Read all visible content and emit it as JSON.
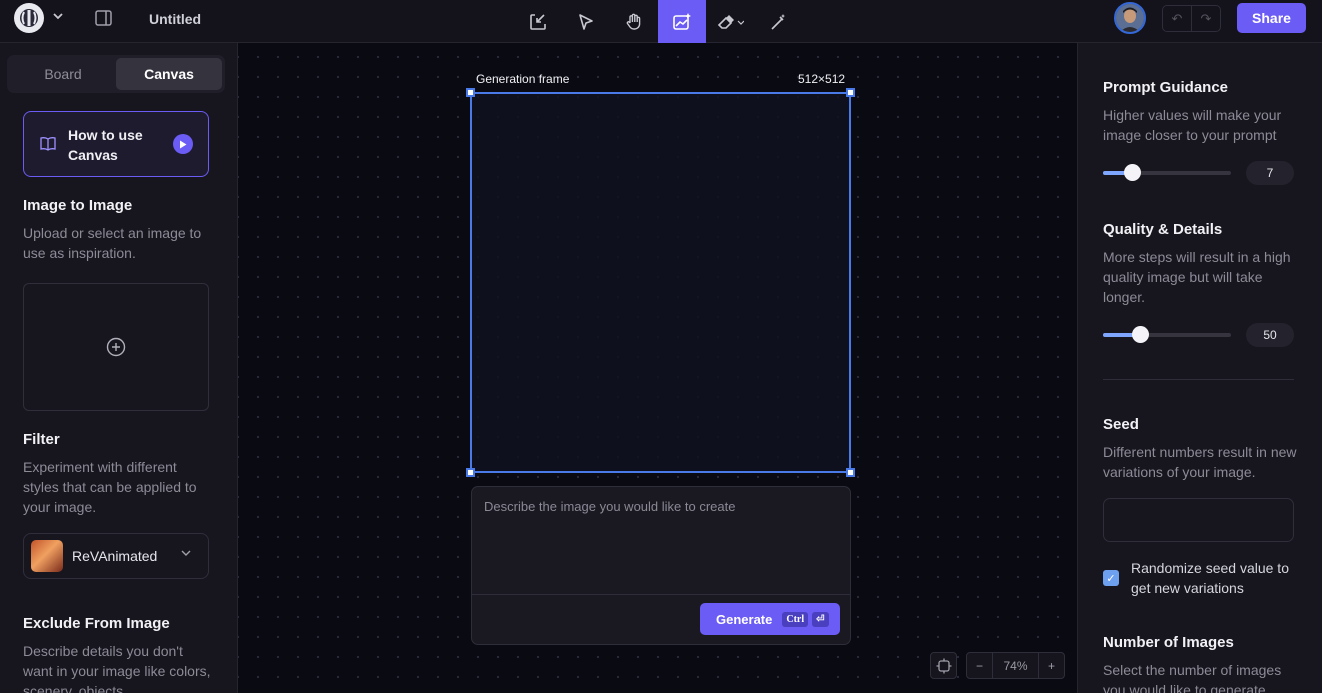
{
  "header": {
    "doc_title": "Untitled",
    "share_label": "Share",
    "undo_icon": "undo-icon",
    "redo_icon": "redo-icon",
    "accent": "#6b5cf5"
  },
  "tools": [
    {
      "name": "import-tool",
      "icon": "import-icon"
    },
    {
      "name": "select-tool",
      "icon": "pointer-icon"
    },
    {
      "name": "pan-tool",
      "icon": "hand-icon"
    },
    {
      "name": "generate-tool",
      "icon": "image-sparkle-icon",
      "active": true
    },
    {
      "name": "eraser-tool",
      "icon": "eraser-icon"
    },
    {
      "name": "magic-wand-tool",
      "icon": "magic-wand-icon"
    }
  ],
  "left": {
    "tabs": [
      "Board",
      "Canvas"
    ],
    "active_tab": "Canvas",
    "howto_label": "How to use Canvas",
    "img2img": {
      "title": "Image to Image",
      "desc": "Upload or select an image to use as inspiration."
    },
    "filter": {
      "title": "Filter",
      "desc": "Experiment with different styles that can be applied to your image.",
      "selected": "ReVAnimated"
    },
    "exclude": {
      "title": "Exclude From Image",
      "desc": "Describe details you don't want in your image like colors, scenery, objects"
    }
  },
  "canvas": {
    "frame_label": "Generation frame",
    "frame_size": "512×512",
    "prompt_placeholder": "Describe the image you would like to create",
    "generate_label": "Generate",
    "shortcut_key": "Ctrl",
    "shortcut_enter": "⏎",
    "zoom": "74%",
    "zoom_minus": "−",
    "zoom_plus": "+"
  },
  "right": {
    "guidance": {
      "title": "Prompt Guidance",
      "desc": "Higher values will make your image closer to your prompt",
      "value": "7",
      "fraction": 0.23
    },
    "quality": {
      "title": "Quality & Details",
      "desc": "More steps will result in a high quality image but will take longer.",
      "value": "50",
      "fraction": 0.29
    },
    "seed": {
      "title": "Seed",
      "desc": "Different numbers result in new variations of your image.",
      "value": ""
    },
    "randomize_label": "Randomize seed value to get new variations",
    "randomize_checked": true,
    "num_images": {
      "title": "Number of Images",
      "desc": "Select the number of images you would like to generate."
    }
  }
}
